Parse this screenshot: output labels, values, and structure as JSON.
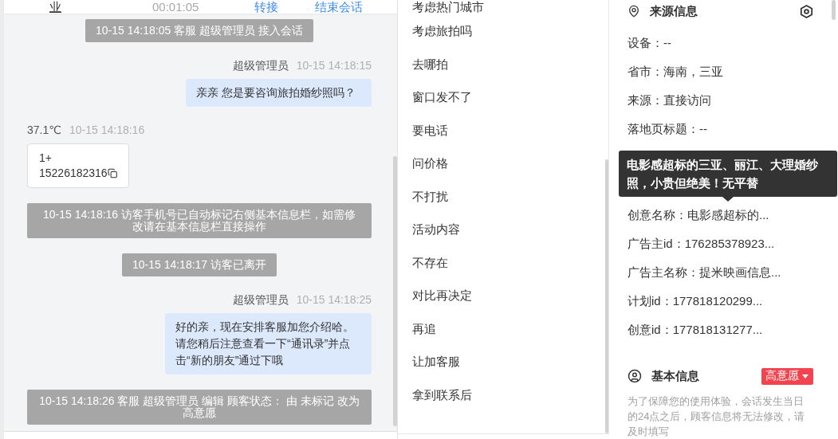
{
  "top_bar": {
    "visitor": "业",
    "duration": "00:01:05",
    "actions": [
      "转接",
      "结束会话"
    ]
  },
  "messages": [
    {
      "kind": "system",
      "text": "10-15 14:18:05 客服 超级管理员 接入会话"
    },
    {
      "kind": "agent",
      "sender": "超级管理员",
      "time": "10-15 14:18:15",
      "text": "亲亲 您是要咨询旅拍婚纱照吗？"
    },
    {
      "kind": "visitor_card",
      "sender": "37.1℃",
      "time": "10-15 14:18:16",
      "lines": [
        "1+",
        "15226182316"
      ]
    },
    {
      "kind": "system",
      "text": "10-15 14:18:16 访客手机号已自动标记右侧基本信息栏，如需修改请在基本信息栏直接操作"
    },
    {
      "kind": "system",
      "text": "10-15 14:18:17 访客已离开"
    },
    {
      "kind": "agent",
      "sender": "超级管理员",
      "time": "10-15 14:18:25",
      "text": "好的亲，现在安排客服加您介绍哈。请您稍后注意查看一下“通讯录”并点击“新的朋友”通过下哦"
    },
    {
      "kind": "system",
      "text": "10-15 14:18:26 客服 超级管理员 编辑 顾客状态： 由 未标记 改为高意愿"
    }
  ],
  "quick_replies": [
    "考虑热门城市",
    "考虑旅拍吗",
    "去哪拍",
    "窗口发不了",
    "要电话",
    "问价格",
    "不打扰",
    "活动内容",
    "不存在",
    "对比再决定",
    "再追",
    "让加客服",
    "拿到联系后"
  ],
  "source_info": {
    "title": "来源信息",
    "rows_above": [
      "设备：--",
      "省市：海南，三亚",
      "来源：直接访问",
      "落地页标题：--"
    ],
    "tooltip": {
      "text": "电影感超标的三亚、丽江、大理婚纱照，小贵但绝美！无平替"
    },
    "rows_below": [
      "创意名称：电影感超标的...",
      "广告主id：176285378923...",
      "广告主名称：提米映画信息...",
      "计划id：177818120299...",
      "创意id：177818131277..."
    ]
  },
  "basic_info": {
    "title": "基本信息",
    "status": "高意愿",
    "notice": "为了保障您的使用体验，会话发生当日的24点之后，顾客信息将无法修改，请及时填写"
  }
}
